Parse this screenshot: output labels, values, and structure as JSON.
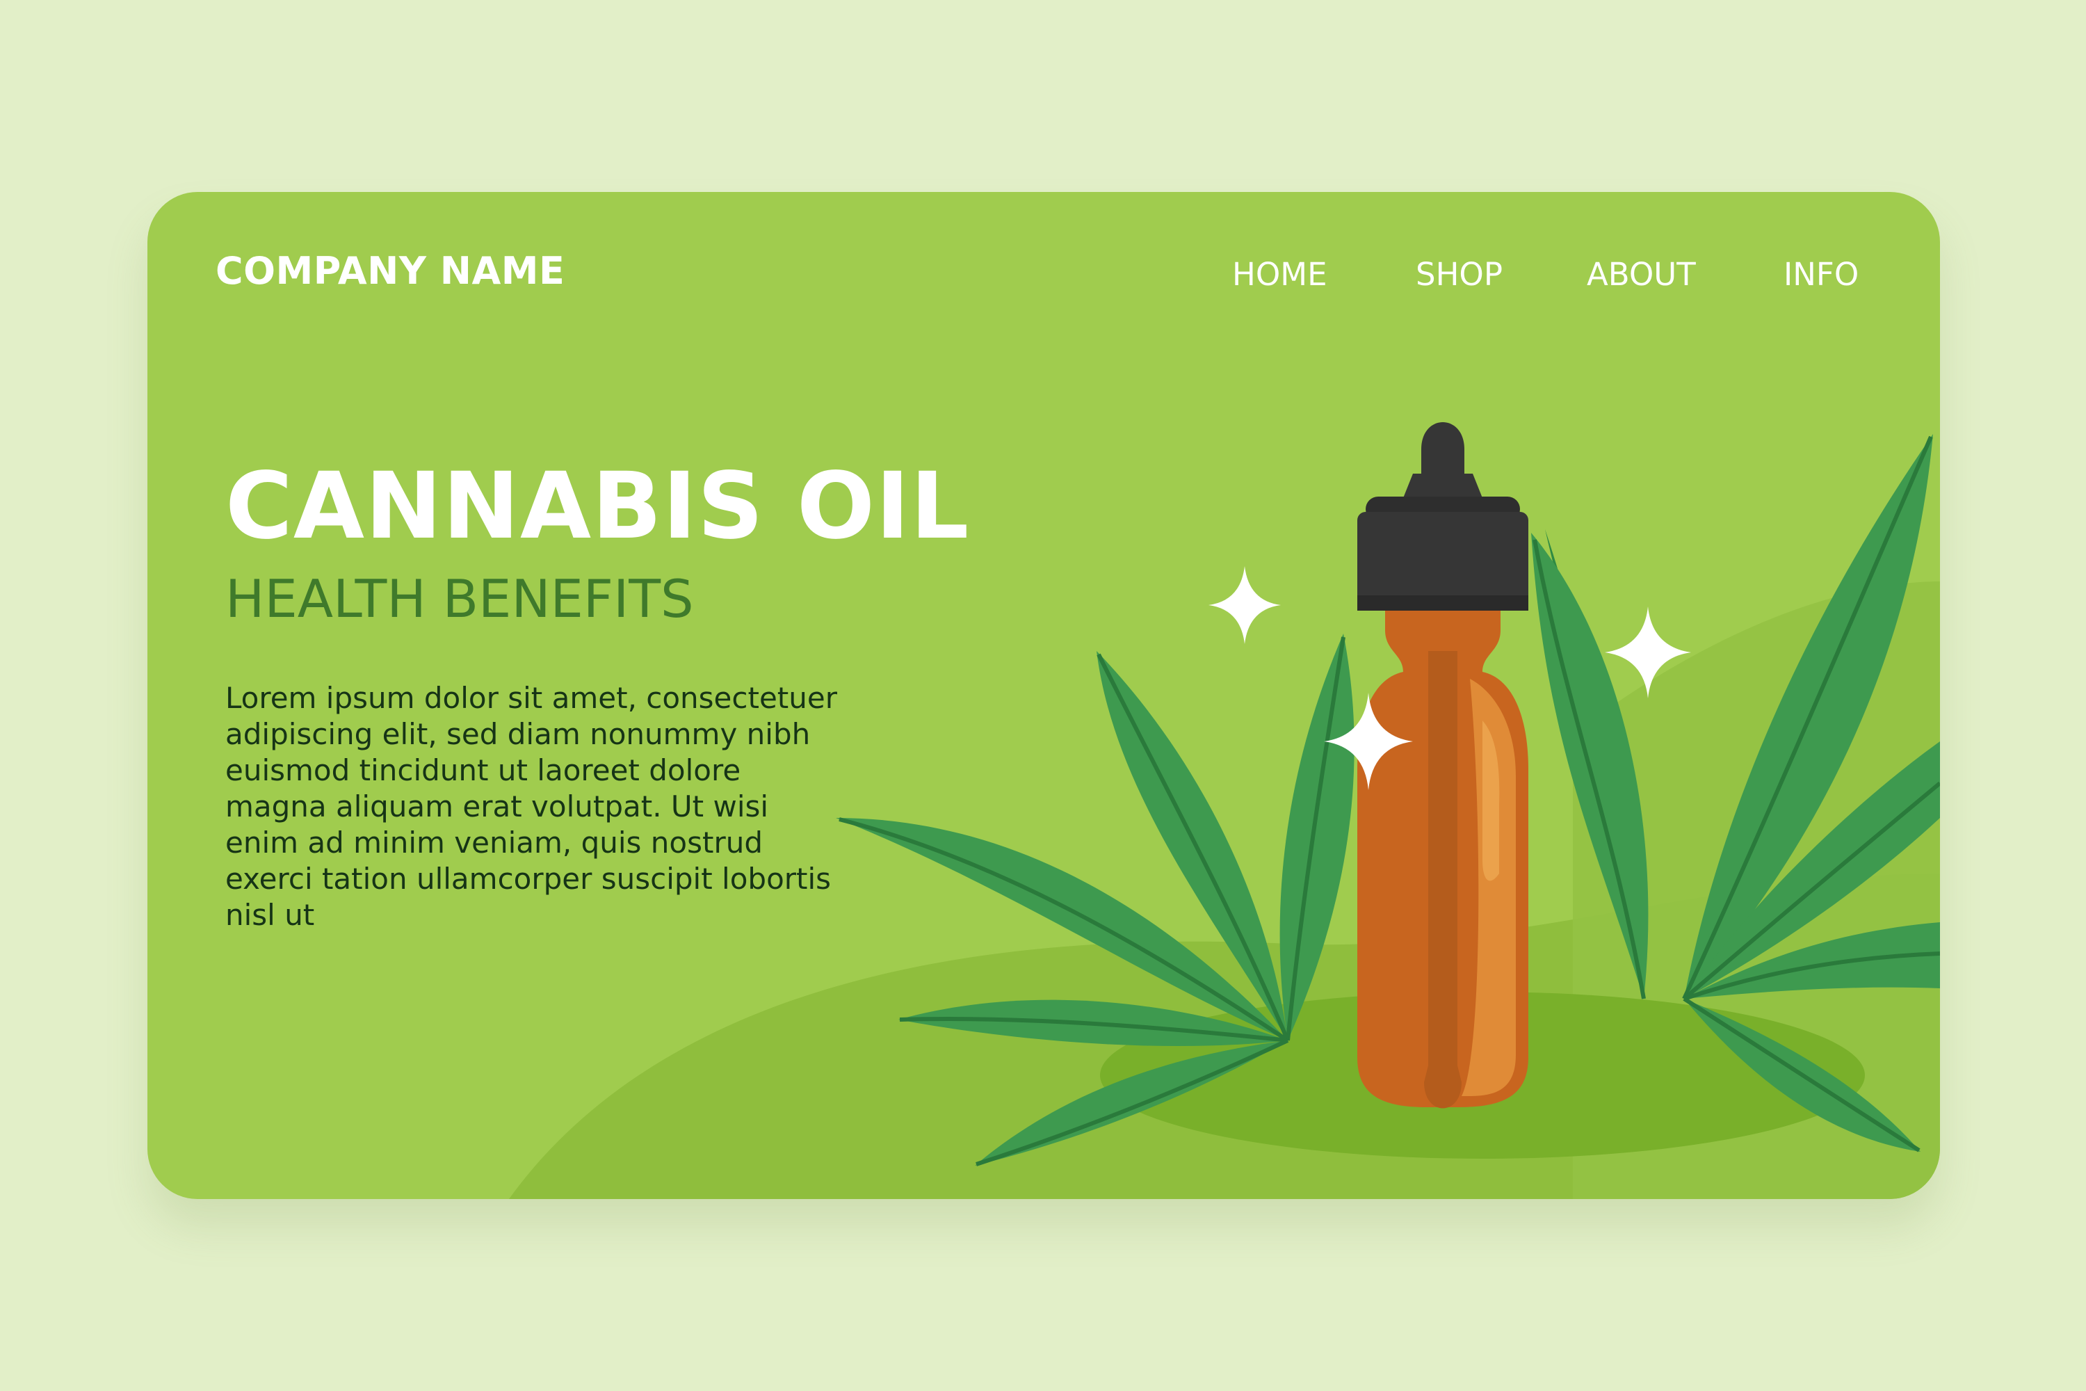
{
  "header": {
    "brand": "COMPANY NAME",
    "nav": [
      "HOME",
      "SHOP",
      "ABOUT",
      "INFO"
    ]
  },
  "hero": {
    "title": "CANNABIS OIL",
    "subtitle": "HEALTH BENEFITS",
    "body_lines": [
      "Lorem ipsum dolor sit amet, consectetuer",
      "adipiscing elit, sed diam nonummy nibh",
      "euismod tincidunt ut laoreet dolore",
      "magna aliquam erat volutpat. Ut wisi",
      "enim ad minim veniam, quis nostrud",
      "exerci tation ullamcorper suscipit lobortis",
      "nisl ut"
    ]
  },
  "illustration": {
    "icons": [
      "dropper-bottle-icon",
      "cannabis-leaf-icon",
      "sparkle-icon"
    ]
  },
  "colors": {
    "page_background": "#e2efc8",
    "card": "#a0cc4e",
    "card_hill": "#8fbe3d",
    "ground_shadow": "#79b02a",
    "leaf": "#3e9a4f",
    "leaf_dark": "#2c7a3d",
    "bottle": "#c8651f",
    "bottle_highlight": "#e28f3a",
    "cap": "#363636",
    "title": "#ffffff",
    "subtitle": "#3f7a2b",
    "body_text": "#163416"
  }
}
